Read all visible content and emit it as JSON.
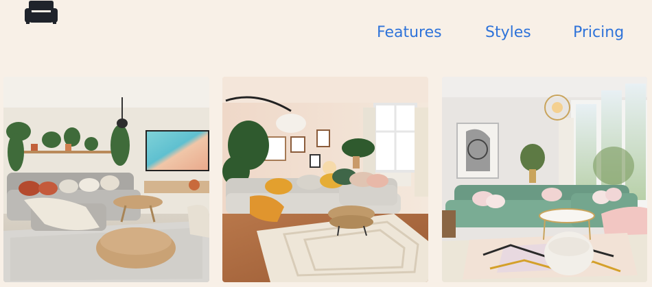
{
  "header": {
    "logo_icon": "sofa-icon",
    "logo_color": "#1f232b"
  },
  "nav": {
    "items": [
      {
        "label": "Features"
      },
      {
        "label": "Styles"
      },
      {
        "label": "Pricing"
      }
    ],
    "link_color": "#2f73d9"
  },
  "gallery": {
    "items": [
      {
        "icon": "living-room-boho-image"
      },
      {
        "icon": "living-room-arc-lamp-image"
      },
      {
        "icon": "living-room-green-sofa-image"
      }
    ]
  },
  "colors": {
    "background": "#f8f0e7"
  }
}
